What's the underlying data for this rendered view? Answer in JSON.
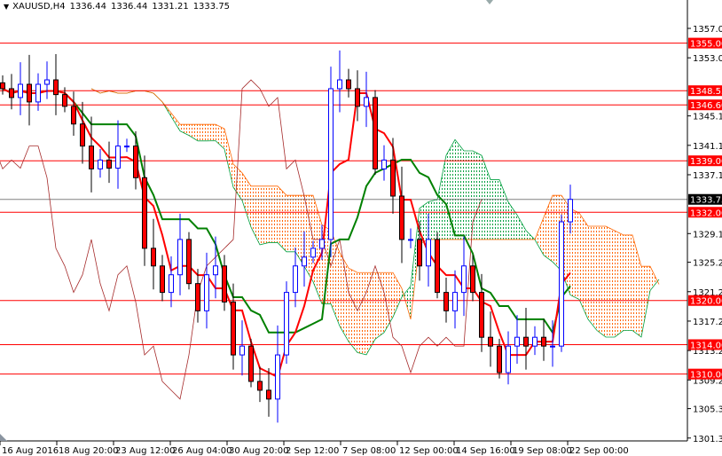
{
  "header": {
    "symbol": "XAUUSD,H4",
    "open": "1336.44",
    "high": "1336.44",
    "low": "1331.21",
    "close": "1333.75",
    "menu_icon": "triangle-down-icon"
  },
  "chart_data": {
    "type": "candlestick",
    "title": "XAUUSD,H4",
    "ylim": [
      1301.3,
      1359.5
    ],
    "y_ticks": [
      "1357.00",
      "1353.00",
      "1345.10",
      "1341.10",
      "1337.10",
      "1329.10",
      "1325.20",
      "1321.20",
      "1317.20",
      "1313.20",
      "1309.20",
      "1305.30",
      "1301.30"
    ],
    "x_ticks": [
      "16 Aug 2016",
      "18 Aug 20:00",
      "23 Aug 12:00",
      "26 Aug 04:00",
      "30 Aug 20:00",
      "2 Sep 12:00",
      "7 Sep 08:00",
      "12 Sep 00:00",
      "14 Sep 16:00",
      "19 Sep 08:00",
      "22 Sep 00:00"
    ],
    "closes": [
      1348.8,
      1347.6,
      1349.4,
      1347,
      1349.4,
      1350,
      1348,
      1346.4,
      1344,
      1341,
      1337.9,
      1339.1,
      1338,
      1341,
      1341,
      1336.7,
      1327.1,
      1324.7,
      1321.1,
      1323.5,
      1328.3,
      1322.3,
      1318.6,
      1323.5,
      1324.7,
      1319.8,
      1312.6,
      1313.8,
      1309,
      1307.8,
      1306.6,
      1312.6,
      1321.1,
      1324.7,
      1325.9,
      1327.1,
      1328.3,
      1348.8,
      1350,
      1348.8,
      1346.4,
      1347.6,
      1337.9,
      1339.1,
      1334.2,
      1328.3,
      1328.3,
      1324.7,
      1328.3,
      1321.1,
      1318.6,
      1321.1,
      1324.7,
      1321.1,
      1315,
      1313.8,
      1310.2,
      1313.8,
      1315,
      1313.8,
      1315,
      1313.8,
      1313.8,
      1330.7,
      1333.75
    ],
    "horizontal_levels": [
      {
        "price": "1355.00",
        "value": 1355.0
      },
      {
        "price": "1348.53",
        "value": 1348.53
      },
      {
        "price": "1346.60",
        "value": 1346.6
      },
      {
        "price": "1339.00",
        "value": 1339.0
      },
      {
        "price": "1332.00",
        "value": 1332.0
      },
      {
        "price": "1320.00",
        "value": 1320.0
      },
      {
        "price": "1314.00",
        "value": 1314.0
      },
      {
        "price": "1310.00",
        "value": 1310.0
      }
    ],
    "current_price": {
      "label": "1333.75",
      "value": 1333.75
    },
    "indicator": "Ichimoku",
    "colors": {
      "bull": "#0000ff",
      "bear_body": "#ff0000",
      "tenkan": "#ff0000",
      "kijun": "#008000",
      "chikou": "#a52a2a",
      "cloud_bull": "#00a040",
      "cloud_bear": "#ff6600",
      "level": "#ff0000",
      "current": "#808080"
    }
  }
}
